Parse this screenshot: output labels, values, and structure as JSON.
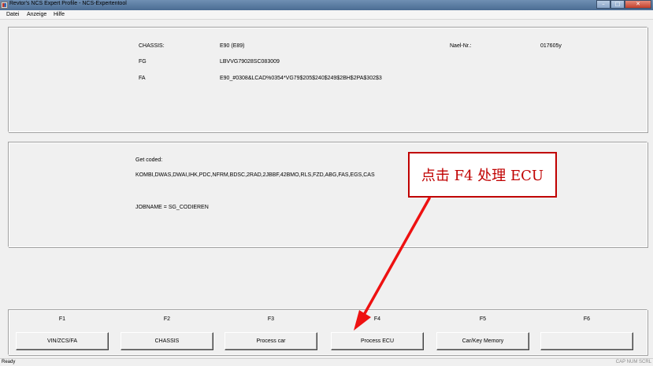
{
  "window": {
    "title": "Revtor's NCS Expert Profile - NCS-Expertentool",
    "minimize": "–",
    "maximize": "□",
    "close": "✕"
  },
  "menu": [
    "Datei",
    "Anzeige",
    "Hilfe"
  ],
  "info": {
    "chassis_label": "CHASSIS:",
    "chassis_value": "E90 (E89)",
    "fg_label": "FG",
    "fg_value": "LBVVG79028SC083009",
    "fa_label": "FA",
    "fa_value": "E90_#0308&LCAD%0354*VG79$205$240$249$2BH$2PA$302$3",
    "nael_label": "Nael-Nr.:",
    "nael_value": "017605y"
  },
  "coding": {
    "get_coded_label": "Get coded:",
    "modules": "KOMBI,DWAS,DWAI,IHK,PDC,NFRM,BDSC,2RAD,2JBBF,42BMO,RLS,FZD,ABG,FAS,EGS,CAS",
    "jobname": "JOBNAME = SG_CODIEREN"
  },
  "function_keys": [
    {
      "key": "F1",
      "label": "VIN/ZCS/FA"
    },
    {
      "key": "F2",
      "label": "CHASSIS"
    },
    {
      "key": "F3",
      "label": "Process car"
    },
    {
      "key": "F4",
      "label": "Process ECU"
    },
    {
      "key": "F5",
      "label": "Car/Key Memory"
    },
    {
      "key": "F6",
      "label": ""
    }
  ],
  "status": {
    "left": "Ready",
    "right": "CAP  NUM  SCRL"
  },
  "annotation": {
    "text": "点击 F4 处理 ECU",
    "color": "#c00000"
  }
}
